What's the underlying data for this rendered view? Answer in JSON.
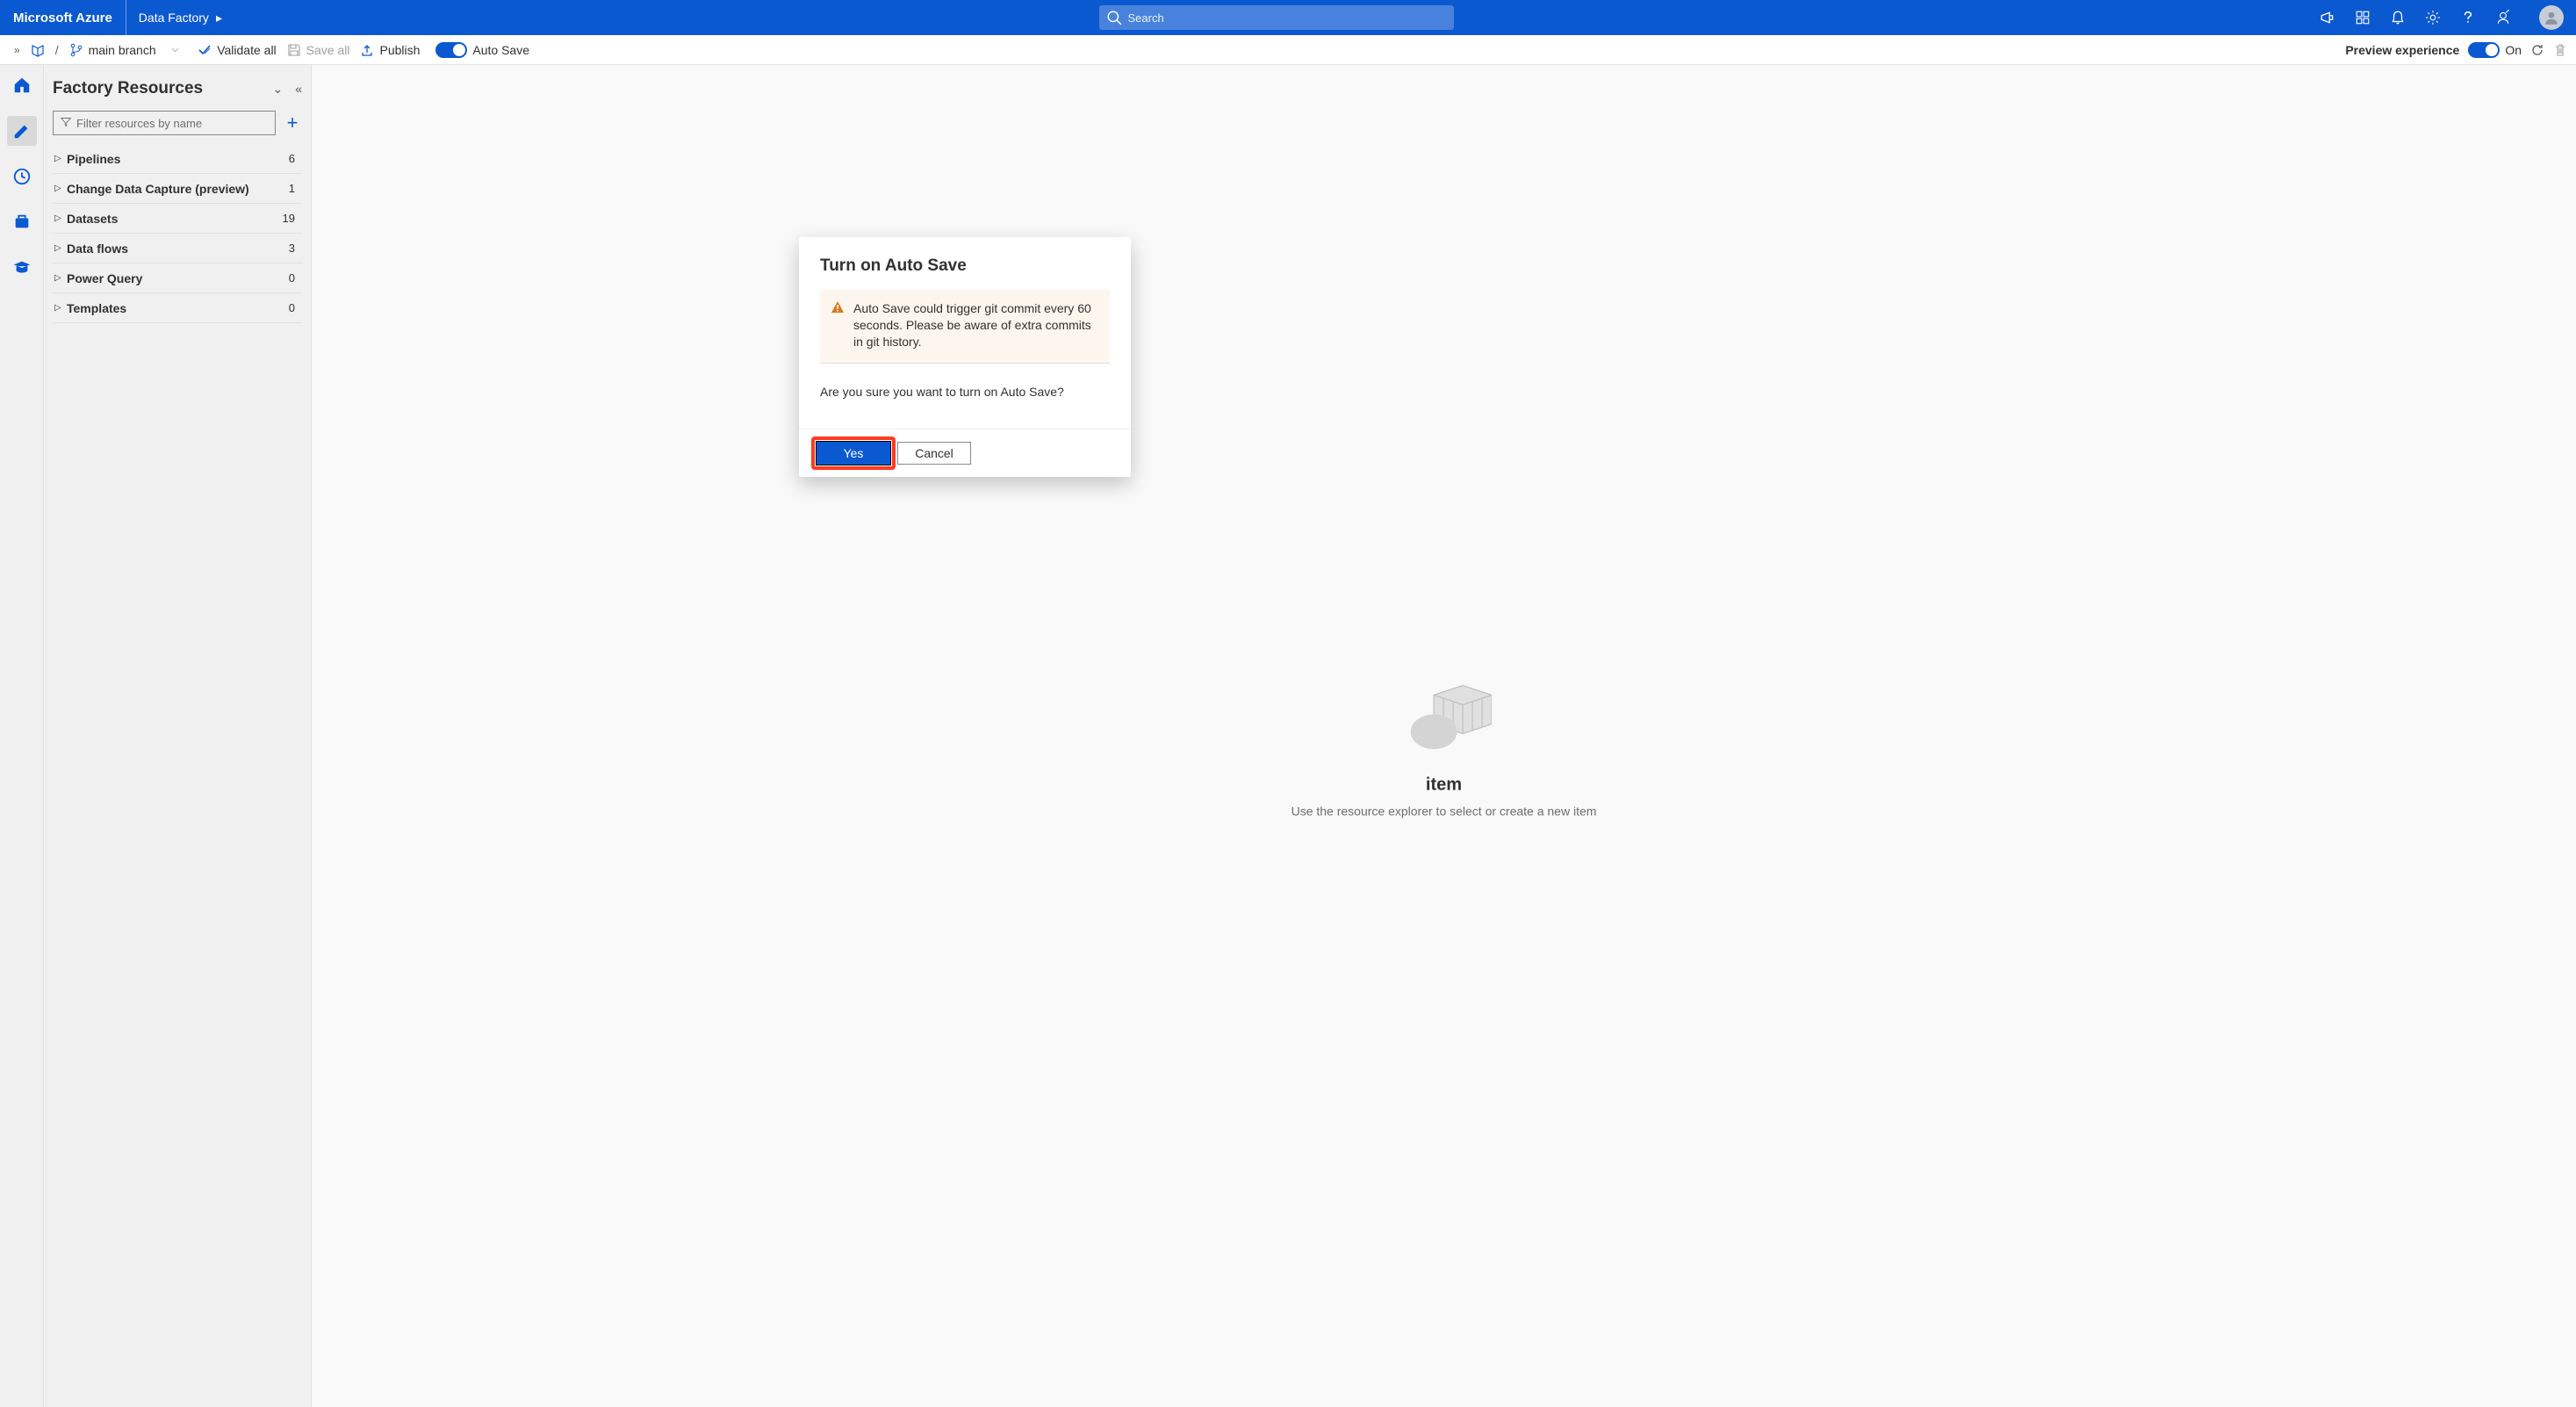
{
  "header": {
    "brand": "Microsoft Azure",
    "crumb": "Data Factory",
    "search_placeholder": "Search"
  },
  "cmdbar": {
    "branch": "main branch",
    "validate": "Validate all",
    "saveall": "Save all",
    "publish": "Publish",
    "autosave": "Auto Save",
    "preview": "Preview experience",
    "preview_state": "On"
  },
  "panel": {
    "title": "Factory Resources",
    "filter_placeholder": "Filter resources by name",
    "items": [
      {
        "label": "Pipelines",
        "count": "6"
      },
      {
        "label": "Change Data Capture (preview)",
        "count": "1"
      },
      {
        "label": "Datasets",
        "count": "19"
      },
      {
        "label": "Data flows",
        "count": "3"
      },
      {
        "label": "Power Query",
        "count": "0"
      },
      {
        "label": "Templates",
        "count": "0"
      }
    ]
  },
  "empty": {
    "title_suffix": " item",
    "subtitle": "Use the resource explorer to select or create a new item"
  },
  "modal": {
    "title": "Turn on Auto Save",
    "warning": "Auto Save could trigger git commit every 60 seconds. Please be aware of extra commits in git history.",
    "question": "Are you sure you want to turn on Auto Save?",
    "yes": "Yes",
    "cancel": "Cancel"
  }
}
